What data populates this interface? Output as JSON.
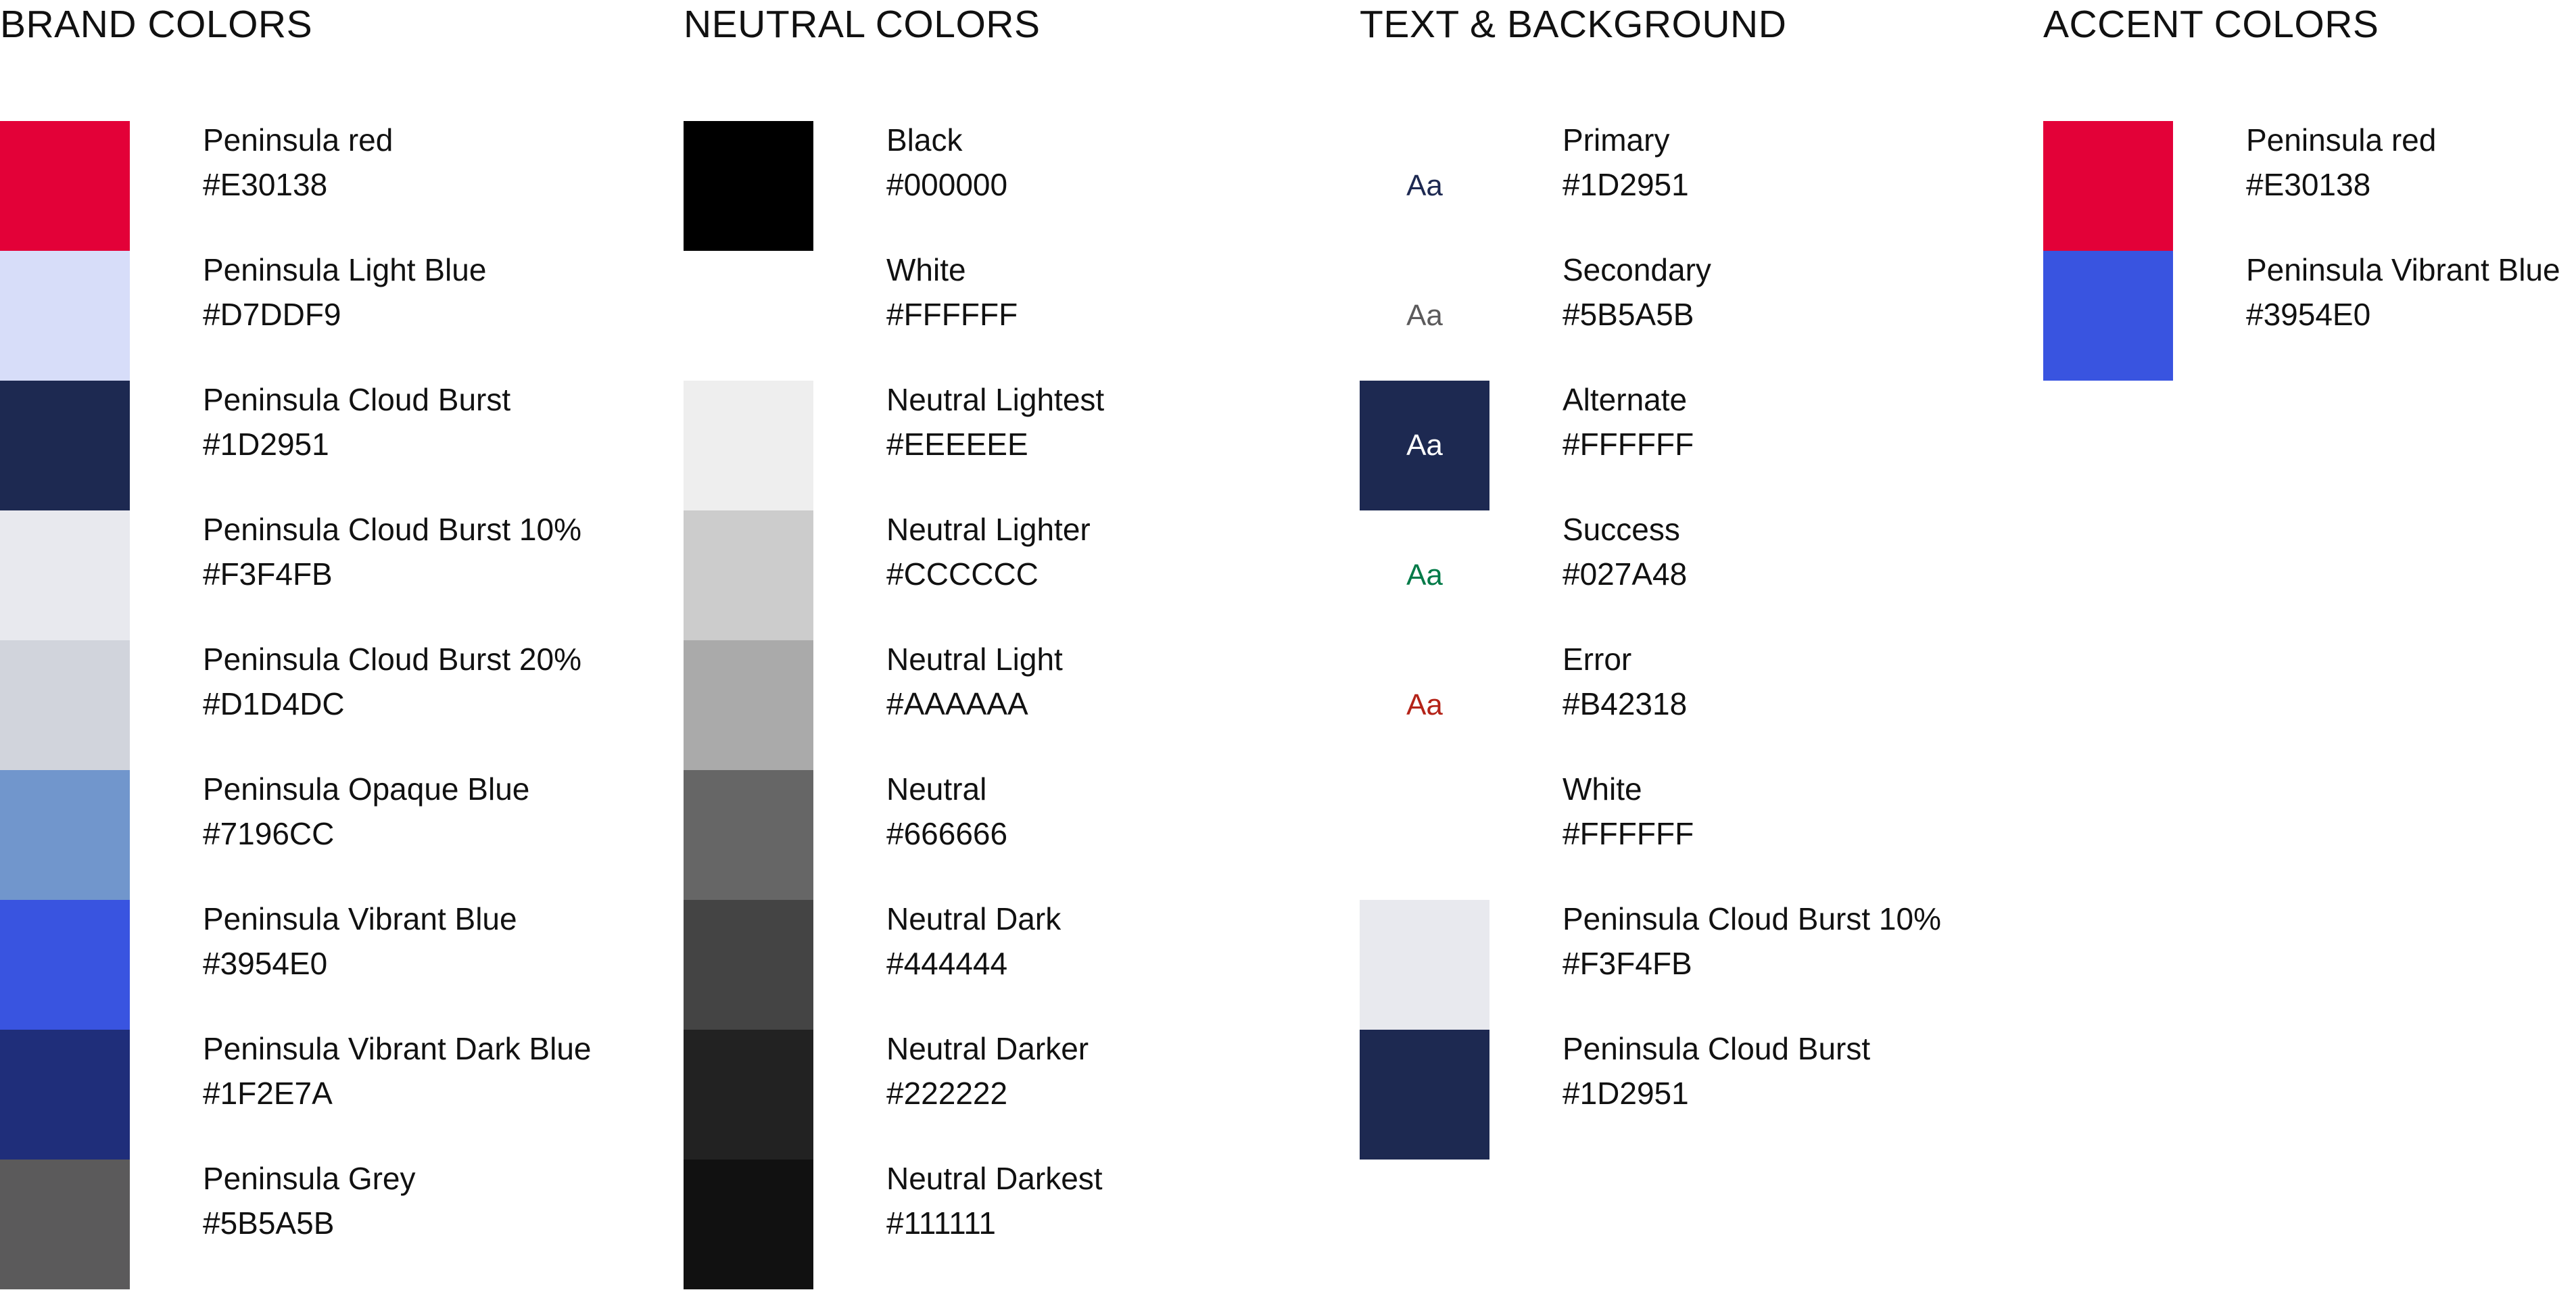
{
  "brand": {
    "title": "BRAND COLORS",
    "items": [
      {
        "name": "Peninsula red",
        "hex": "#E30138",
        "swatch": "#E30138"
      },
      {
        "name": "Peninsula Light Blue",
        "hex": "#D7DDF9",
        "swatch": "#D7DDF9"
      },
      {
        "name": "Peninsula Cloud Burst",
        "hex": "#1D2951",
        "swatch": "#1D2951"
      },
      {
        "name": "Peninsula Cloud Burst 10%",
        "hex": "#F3F4FB",
        "swatch": "#E8E9EE"
      },
      {
        "name": "Peninsula Cloud Burst 20%",
        "hex": "#D1D4DC",
        "swatch": "#D1D4DC"
      },
      {
        "name": "Peninsula Opaque Blue",
        "hex": "#7196CC",
        "swatch": "#7196CC"
      },
      {
        "name": "Peninsula Vibrant Blue",
        "hex": "#3954E0",
        "swatch": "#3954E0"
      },
      {
        "name": "Peninsula Vibrant Dark Blue",
        "hex": "#1F2E7A",
        "swatch": "#1F2E7A"
      },
      {
        "name": "Peninsula Grey",
        "hex": "#5B5A5B",
        "swatch": "#5B5A5B"
      }
    ]
  },
  "neutral": {
    "title": "NEUTRAL COLORS",
    "items": [
      {
        "name": "Black",
        "hex": "#000000",
        "swatch": "#000000"
      },
      {
        "name": "White",
        "hex": "#FFFFFF",
        "swatch": "#FFFFFF"
      },
      {
        "name": "Neutral Lightest",
        "hex": "#EEEEEE",
        "swatch": "#EEEEEE"
      },
      {
        "name": "Neutral Lighter",
        "hex": "#CCCCCC",
        "swatch": "#CCCCCC"
      },
      {
        "name": "Neutral Light",
        "hex": "#AAAAAA",
        "swatch": "#AAAAAA"
      },
      {
        "name": "Neutral",
        "hex": "#666666",
        "swatch": "#666666"
      },
      {
        "name": "Neutral Dark",
        "hex": "#444444",
        "swatch": "#444444"
      },
      {
        "name": "Neutral Darker",
        "hex": "#222222",
        "swatch": "#222222"
      },
      {
        "name": "Neutral Darkest",
        "hex": "#111111",
        "swatch": "#111111"
      }
    ]
  },
  "text_background": {
    "title": "TEXT & BACKGROUND",
    "items": [
      {
        "name": "Primary",
        "hex": "#1D2951",
        "swatch": "#FFFFFF",
        "sample": "Aa",
        "sample_color": "#1D2951"
      },
      {
        "name": "Secondary",
        "hex": "#5B5A5B",
        "swatch": "#FFFFFF",
        "sample": "Aa",
        "sample_color": "#5B5A5B"
      },
      {
        "name": "Alternate",
        "hex": "#FFFFFF",
        "swatch": "#1D2951",
        "sample": "Aa",
        "sample_color": "#FFFFFF"
      },
      {
        "name": "Success",
        "hex": "#027A48",
        "swatch": "#FFFFFF",
        "sample": "Aa",
        "sample_color": "#027A48"
      },
      {
        "name": "Error",
        "hex": "#B42318",
        "swatch": "#FFFFFF",
        "sample": "Aa",
        "sample_color": "#B42318"
      },
      {
        "name": "White",
        "hex": "#FFFFFF",
        "swatch": "#FFFFFF",
        "sample": "",
        "sample_color": "#FFFFFF"
      },
      {
        "name": "Peninsula Cloud Burst 10%",
        "hex": "#F3F4FB",
        "swatch": "#E8E9EE",
        "sample": "",
        "sample_color": "#E8E9EE"
      },
      {
        "name": "Peninsula Cloud Burst",
        "hex": "#1D2951",
        "swatch": "#1D2951",
        "sample": "",
        "sample_color": "#1D2951"
      }
    ]
  },
  "accent": {
    "title": "ACCENT COLORS",
    "items": [
      {
        "name": "Peninsula red",
        "hex": "#E30138",
        "swatch": "#E30138"
      },
      {
        "name": "Peninsula Vibrant Blue",
        "hex": "#3954E0",
        "swatch": "#3954E0"
      }
    ]
  }
}
